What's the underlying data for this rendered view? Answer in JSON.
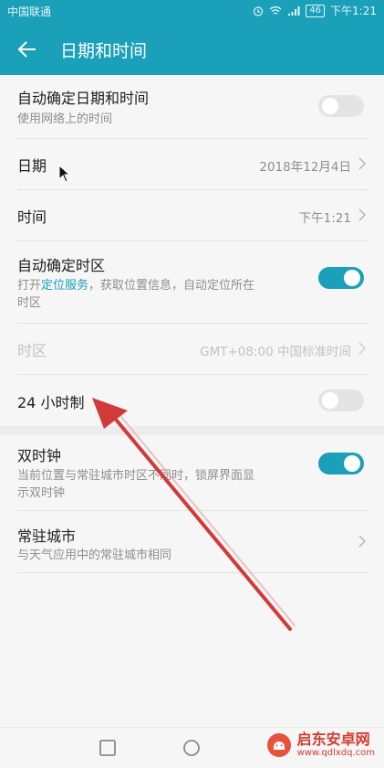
{
  "status_bar": {
    "carrier": "中国联通",
    "battery": "46",
    "time": "下午1:21"
  },
  "header": {
    "title": "日期和时间",
    "background": "#1aa0b8"
  },
  "settings": {
    "auto_datetime": {
      "title": "自动确定日期和时间",
      "subtitle": "使用网络上的时间",
      "switch": "off"
    },
    "date": {
      "title": "日期",
      "value": "2018年12月4日"
    },
    "time": {
      "title": "时间",
      "value": "下午1:21"
    },
    "auto_timezone": {
      "title": "自动确定时区",
      "subtitle_pre": "打开",
      "subtitle_link": "定位服务",
      "subtitle_post": "，获取位置信息，自动定位所在",
      "subtitle_line2": "时区",
      "switch": "on"
    },
    "timezone": {
      "title": "时区",
      "value": "GMT+08:00 中国标准时间",
      "enabled": false
    },
    "hour24": {
      "title": "24 小时制",
      "switch": "off"
    },
    "dual_clock": {
      "title": "双时钟",
      "subtitle_line1": "当前位置与常驻城市时区不同时，锁屏界面显",
      "subtitle_line2": "示双时钟",
      "switch": "on"
    },
    "home_city": {
      "title": "常驻城市",
      "subtitle": "与天气应用中的常驻城市相同"
    }
  },
  "nav": {
    "icons": [
      "square-icon",
      "circle-icon"
    ]
  },
  "watermark": {
    "name": "启东安卓网",
    "url": "www.qdlxdq.com"
  },
  "colors": {
    "accent": "#1aa0b8",
    "annotation": "#d23a3a"
  }
}
